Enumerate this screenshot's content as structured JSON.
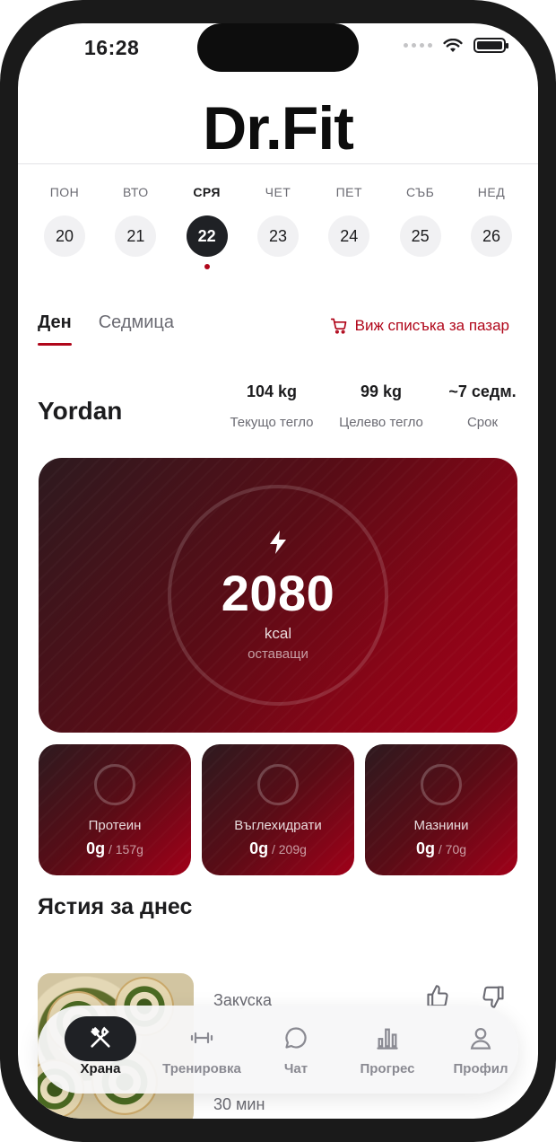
{
  "status_bar": {
    "time": "16:28"
  },
  "app": {
    "logo": "Dr.Fit"
  },
  "week": [
    {
      "name": "ПОН",
      "date": "20",
      "active": false
    },
    {
      "name": "ВТО",
      "date": "21",
      "active": false
    },
    {
      "name": "СРЯ",
      "date": "22",
      "active": true
    },
    {
      "name": "ЧЕТ",
      "date": "23",
      "active": false
    },
    {
      "name": "ПЕТ",
      "date": "24",
      "active": false
    },
    {
      "name": "СЪБ",
      "date": "25",
      "active": false
    },
    {
      "name": "НЕД",
      "date": "26",
      "active": false
    }
  ],
  "tabs": {
    "day": "Ден",
    "week": "Седмица"
  },
  "shopping_link": "Виж списъка за пазар",
  "user": {
    "name": "Yordan",
    "stats": [
      {
        "value": "104 kg",
        "label": "Текущо тегло"
      },
      {
        "value": "99 kg",
        "label": "Целево тегло"
      },
      {
        "value": "~7 седм.",
        "label": "Срок"
      }
    ]
  },
  "calories": {
    "value": "2080",
    "unit": "kcal",
    "caption": "оставащи"
  },
  "macros": [
    {
      "name": "Протеин",
      "current": "0g",
      "total": "157g"
    },
    {
      "name": "Въглехидрати",
      "current": "0g",
      "total": "209g"
    },
    {
      "name": "Мазнини",
      "current": "0g",
      "total": "70g"
    }
  ],
  "meals_section": {
    "title": "Ястия за днес"
  },
  "meal": {
    "type": "Закуска",
    "time": "30 мин"
  },
  "nav": [
    {
      "label": "Храна",
      "icon": "fork-knife-icon",
      "active": true
    },
    {
      "label": "Тренировка",
      "icon": "dumbbell-icon",
      "active": false
    },
    {
      "label": "Чат",
      "icon": "chat-bubble-icon",
      "active": false
    },
    {
      "label": "Прогрес",
      "icon": "bar-chart-icon",
      "active": false
    },
    {
      "label": "Профил",
      "icon": "person-icon",
      "active": false
    }
  ],
  "colors": {
    "accent": "#b0061a",
    "dark": "#1f2125"
  }
}
